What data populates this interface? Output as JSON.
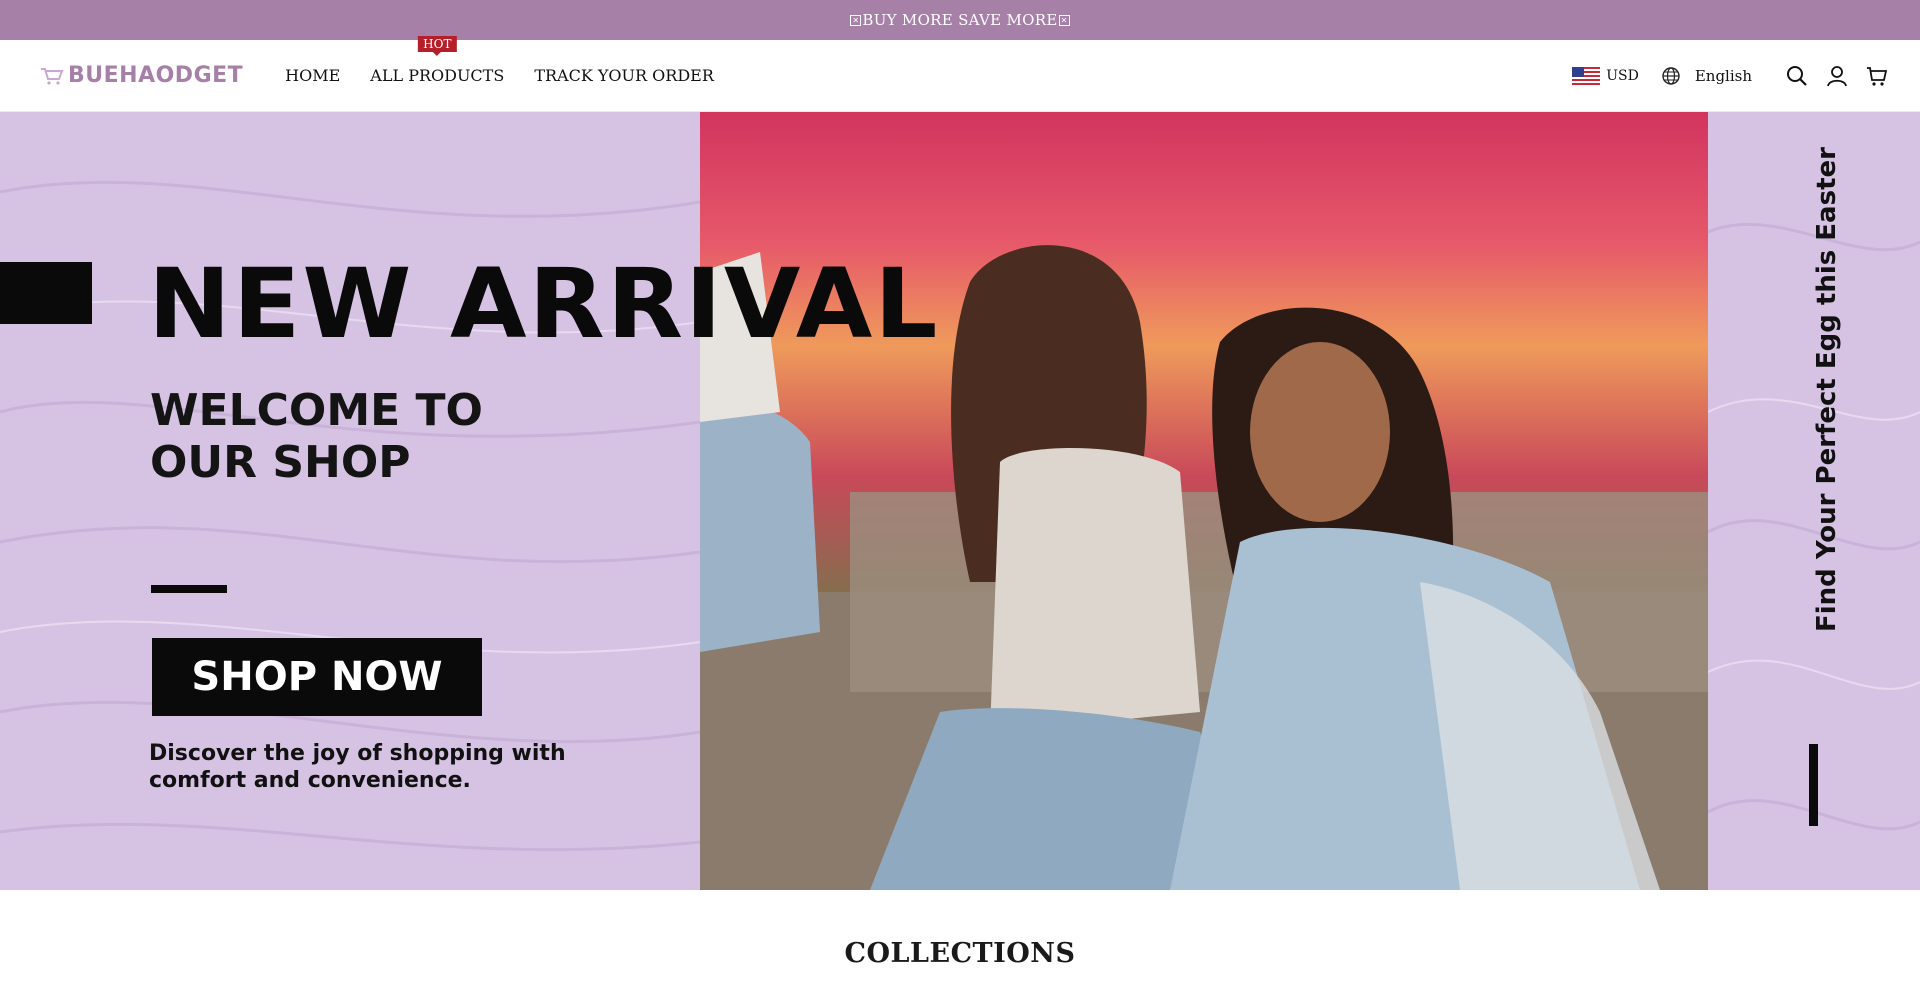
{
  "announcement": {
    "text": "BUY MORE SAVE MORE"
  },
  "header": {
    "logo": "BUEHAODGET",
    "nav": [
      {
        "label": "HOME"
      },
      {
        "label": "ALL PRODUCTS",
        "badge": "HOT"
      },
      {
        "label": "TRACK YOUR ORDER"
      }
    ],
    "currency": "USD",
    "language": "English",
    "icons": [
      "search-icon",
      "account-icon",
      "cart-icon"
    ]
  },
  "hero": {
    "headline": "NEW ARRIVAL",
    "welcome_line1": "WELCOME TO",
    "welcome_line2": "OUR SHOP",
    "cta": "SHOP NOW",
    "description": "Discover the joy of shopping with comfort and convenience.",
    "side_text": "Find Your Perfect Egg this Easter"
  },
  "collections": {
    "title": "COLLECTIONS"
  },
  "colors": {
    "announcement_bg": "#a680a6",
    "hero_bg": "#d8c7e6",
    "hot_badge": "#b51f2a",
    "logo": "#a680a6"
  }
}
